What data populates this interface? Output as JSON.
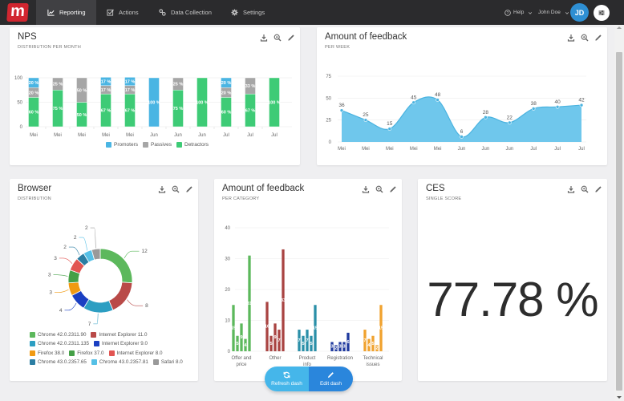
{
  "nav": {
    "logo": "m",
    "tabs": [
      {
        "label": "Reporting",
        "icon": "chart-line-icon",
        "active": true
      },
      {
        "label": "Actions",
        "icon": "checkbox-icon",
        "active": false
      },
      {
        "label": "Data Collection",
        "icon": "link-icon",
        "active": false
      },
      {
        "label": "Settings",
        "icon": "gear-icon",
        "active": false
      }
    ],
    "help": "Help",
    "user": "John Doe",
    "avatar": "JD"
  },
  "cards": {
    "nps": {
      "title": "NPS",
      "subtitle": "DISTRIBUTION PER MONTH"
    },
    "feedback_week": {
      "title": "Amount of feedback",
      "subtitle": "PER WEEK"
    },
    "browser": {
      "title": "Browser",
      "subtitle": "DISTRIBUTION"
    },
    "feedback_category": {
      "title": "Amount of feedback",
      "subtitle": "PER CATEGORY"
    },
    "ces": {
      "title": "CES",
      "subtitle": "SINGLE SCORE",
      "value": "77.78 %"
    }
  },
  "buttons": {
    "refresh": "Refresh dash",
    "edit": "Edit dash"
  },
  "chart_data": [
    {
      "id": "nps",
      "type": "bar",
      "stacked": true,
      "title": "NPS",
      "subtitle": "DISTRIBUTION PER MONTH",
      "categories": [
        "Mei",
        "Mei",
        "Mei",
        "Mei",
        "Mei",
        "Jun",
        "Jun",
        "Jun",
        "Jul",
        "Jul",
        "Jul"
      ],
      "series": [
        {
          "name": "Promoters",
          "color": "#4ab5e3",
          "values": [
            20,
            0,
            0,
            17,
            17,
            100,
            0,
            0,
            20,
            0,
            0
          ]
        },
        {
          "name": "Passives",
          "color": "#a6a6a6",
          "values": [
            20,
            25,
            50,
            17,
            17,
            0,
            25,
            0,
            20,
            33,
            0
          ]
        },
        {
          "name": "Detractors",
          "color": "#3ecb76",
          "values": [
            60,
            75,
            50,
            67,
            67,
            0,
            75,
            100,
            60,
            67,
            100
          ]
        }
      ],
      "label_suffix": " %",
      "ylim": [
        0,
        100
      ],
      "yticks": [
        0,
        50,
        100
      ],
      "grid": true,
      "legend": "bottom-center"
    },
    {
      "id": "feedback_week",
      "type": "area",
      "title": "Amount of feedback",
      "subtitle": "PER WEEK",
      "x": [
        "Mei",
        "Mei",
        "Mei",
        "Mei",
        "Mei",
        "Jun",
        "Jun",
        "Jun",
        "Jul",
        "Jul",
        "Jul"
      ],
      "values": [
        36,
        25,
        15,
        45,
        48,
        6,
        28,
        22,
        38,
        40,
        42
      ],
      "color": "#4ab3e0",
      "fill": "#6fc7ec",
      "ylim": [
        0,
        75
      ],
      "yticks": [
        0,
        25,
        50,
        75
      ],
      "grid": true
    },
    {
      "id": "browser",
      "type": "pie",
      "donut": true,
      "title": "Browser",
      "subtitle": "DISTRIBUTION",
      "slices": [
        {
          "label": "Chrome 42.0.2311.90",
          "value": 12,
          "color": "#5cb85c"
        },
        {
          "label": "Internet Explorer 11.0",
          "value": 8,
          "color": "#b94a48"
        },
        {
          "label": "Chrome 42.0.2311.135",
          "value": 7,
          "color": "#2c9ec2"
        },
        {
          "label": "Internet Explorer 9.0",
          "value": 4,
          "color": "#1a3fc2"
        },
        {
          "label": "Firefox 38.0",
          "value": 3,
          "color": "#f19a12"
        },
        {
          "label": "Firefox 37.0",
          "value": 3,
          "color": "#45a047"
        },
        {
          "label": "Internet Explorer 8.0",
          "value": 3,
          "color": "#e25552"
        },
        {
          "label": "Chrome 43.0.2357.65",
          "value": 2,
          "color": "#2b7ea3"
        },
        {
          "label": "Chrome 43.0.2357.81",
          "value": 2,
          "color": "#55c0e6"
        },
        {
          "label": "Safari 8.0",
          "value": 2,
          "color": "#999999"
        }
      ],
      "legend": "bottom"
    },
    {
      "id": "feedback_category",
      "type": "bar",
      "title": "Amount of feedback",
      "subtitle": "PER CATEGORY",
      "categories": [
        "Offer and price",
        "Other",
        "Product info",
        "Registration",
        "Technical issues"
      ],
      "groups": [
        {
          "category": "Offer and price",
          "color": "#5cb85c",
          "values": [
            15,
            5,
            9,
            4,
            31
          ]
        },
        {
          "category": "Other",
          "color": "#a94442",
          "values": [
            16,
            5,
            9,
            7,
            33
          ]
        },
        {
          "category": "Product info",
          "color": "#2a8fa8",
          "values": [
            7,
            5,
            7,
            5,
            15
          ]
        },
        {
          "category": "Registration",
          "color": "#1f3a9e",
          "values": [
            3,
            2,
            3,
            3,
            6
          ]
        },
        {
          "category": "Technical issues",
          "color": "#f0a22e",
          "values": [
            7,
            4,
            5,
            2,
            15
          ]
        }
      ],
      "ylim": [
        0,
        40
      ],
      "yticks": [
        0,
        10,
        20,
        30,
        40
      ],
      "grid": true
    }
  ]
}
